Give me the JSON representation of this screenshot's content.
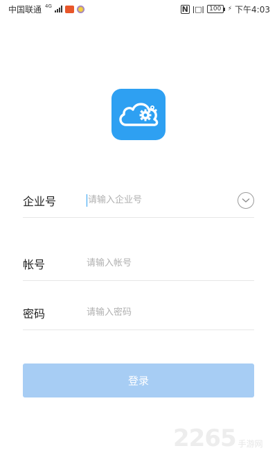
{
  "status_bar": {
    "carrier": "中国联通",
    "network": "4G",
    "battery": "100",
    "time": "下午4:03",
    "icons": [
      "signal-icon",
      "weibo-app-icon",
      "browser-app-icon",
      "nfc-icon",
      "vibrate-icon",
      "battery-icon",
      "charging-icon"
    ]
  },
  "logo": {
    "icon": "cloud-gear-icon",
    "color": "#2ea0f2"
  },
  "form": {
    "company": {
      "label": "企业号",
      "placeholder": "请输入企业号",
      "value": ""
    },
    "account": {
      "label": "帐号",
      "placeholder": "请输入帐号",
      "value": ""
    },
    "password": {
      "label": "密码",
      "placeholder": "请输入密码",
      "value": ""
    }
  },
  "login": {
    "label": "登录",
    "color": "#a7cdf4"
  },
  "watermark": {
    "number": "2265",
    "text": "手游网"
  }
}
